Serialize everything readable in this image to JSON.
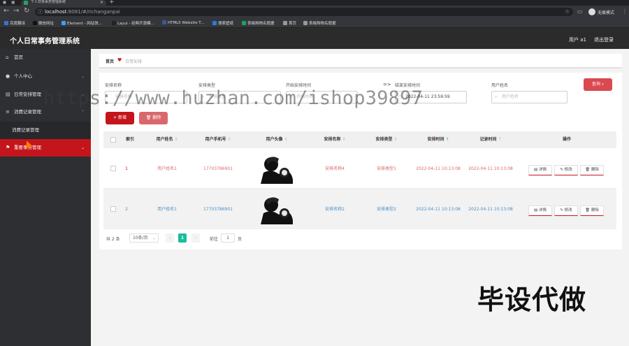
{
  "browser": {
    "tab_title": "个人日常事务管理系统",
    "url_host": "localhost",
    "url_rest": ":8081/#/richanganpai",
    "profile_label": "无痕模式",
    "bookmarks": [
      {
        "label": "百度翻译",
        "color": "#3b6fd8"
      },
      {
        "label": "微信网址",
        "color": "#111111"
      },
      {
        "label": "Element - 网站快...",
        "color": "#409eff"
      },
      {
        "label": "Layui - 经典开源模...",
        "color": "#222222"
      },
      {
        "label": "HTML5 Website T...",
        "color": "#3b5998"
      },
      {
        "label": "搜索壁纸",
        "color": "#2a7ae2"
      },
      {
        "label": "表格购物名题据",
        "color": "#1aa260"
      },
      {
        "label": "首页",
        "color": "#999999"
      },
      {
        "label": "表格购物名题据",
        "color": "#999999"
      }
    ]
  },
  "header": {
    "title": "个人日常事务管理系统",
    "user": "用户 a1",
    "logout": "退出登录"
  },
  "sidebar": {
    "items": [
      {
        "label": "首页",
        "icon": "home-icon"
      },
      {
        "label": "个人中心",
        "icon": "user-icon"
      },
      {
        "label": "日常安排管理",
        "icon": "calendar-icon"
      },
      {
        "label": "消费记录管理",
        "icon": "list-icon"
      },
      {
        "label": "消费记录管理",
        "icon": ""
      },
      {
        "label": "重要事务管理",
        "icon": "flag-icon"
      }
    ]
  },
  "breadcrumb": {
    "home": "首页",
    "current": "日常安排"
  },
  "search": {
    "labels": [
      "安排名称",
      "安排类型",
      "开始安排时间",
      "结束安排时间",
      "用户姓名"
    ],
    "name_placeholder": "安排名称",
    "type_placeholder": "安排类型",
    "start_placeholder": "开始时间",
    "end_value": "2022-04-11 23:59:59",
    "user_placeholder": "用户姓名",
    "arrow": "=>",
    "search_button": "查询"
  },
  "actions": {
    "add": "新增",
    "delete": "删除"
  },
  "table": {
    "headers": [
      "索引",
      "用户姓名",
      "用户手机号",
      "用户头像",
      "安排名称",
      "安排类型",
      "安排时间",
      "记录时间",
      "操作"
    ],
    "rows": [
      {
        "index": "1",
        "user": "用户姓名1",
        "phone": "17703786901",
        "name": "安排名称4",
        "type": "安排类型1",
        "time": "2022-04-11 10:13:08",
        "recorded": "2022-04-11 10:13:08"
      },
      {
        "index": "2",
        "user": "用户姓名1",
        "phone": "17703786901",
        "name": "安排名称2",
        "type": "安排类型2",
        "time": "2022-04-11 10:13:08",
        "recorded": "2022-04-11 10:13:08"
      }
    ],
    "op_labels": [
      "详情",
      "修改",
      "删除"
    ]
  },
  "pagination": {
    "total": "共 2 条",
    "page_size": "10条/页",
    "current": "1",
    "goto_label": "前往",
    "goto_value": "1",
    "page_suffix": "页"
  },
  "overlay": {
    "watermark": "https://www.huzhan.com/ishop39897",
    "stamp": "毕设代做"
  },
  "colors": {
    "accent": "#c4151c",
    "sidebar": "#2d2f33",
    "page_active": "#1abc9c"
  }
}
